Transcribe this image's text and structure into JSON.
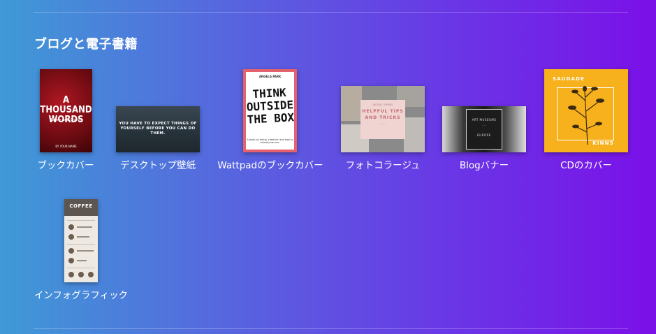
{
  "section": {
    "title": "ブログと電子書籍"
  },
  "templates": [
    {
      "label": "ブックカバー",
      "thumb": {
        "title": "A THOUSAND WORDS",
        "subtitle": "Poems and Stories",
        "author": "BY YOUR NAME"
      }
    },
    {
      "label": "デスクトップ壁紙",
      "thumb": {
        "text": "YOU HAVE TO EXPECT THINGS OF YOURSELF BEFORE YOU CAN DO THEM."
      }
    },
    {
      "label": "Wattpadのブックカバー",
      "thumb": {
        "author": "ANGELA PARK",
        "title": "THINK OUTSIDE THE BOX",
        "subtitle": "A book on being 'creative' and how to actually be one."
      }
    },
    {
      "label": "フォトコラージュ",
      "thumb": {
        "kicker": "DIGITAL TRENDS",
        "title": "HELPFUL TIPS AND TRICKS"
      }
    },
    {
      "label": "Blogバナー",
      "thumb": {
        "title": "ART MUSEUMS",
        "location": "EUROPE"
      }
    },
    {
      "label": "CDのカバー",
      "thumb": {
        "title": "SAUDADE",
        "artist": "KINNS"
      }
    },
    {
      "label": "インフォグラフィック",
      "thumb": {
        "title": "COFFEE"
      }
    }
  ]
}
